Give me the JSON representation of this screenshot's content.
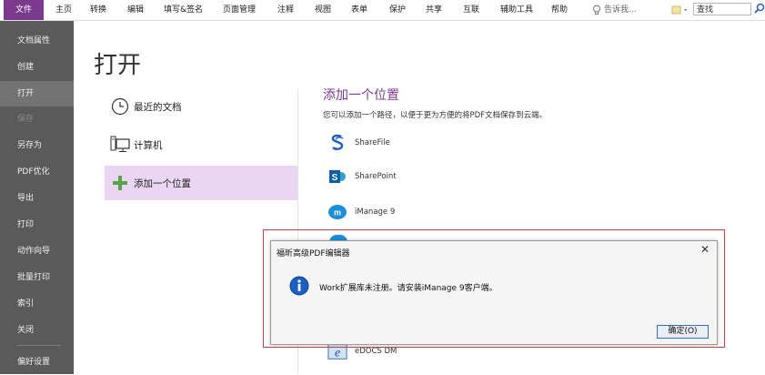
{
  "ribbon": {
    "tabs": [
      {
        "label": "文件",
        "active": true
      },
      {
        "label": "主页"
      },
      {
        "label": "转换"
      },
      {
        "label": "编辑"
      },
      {
        "label": "填写&签名"
      },
      {
        "label": "页面管理"
      },
      {
        "label": "注释"
      },
      {
        "label": "视图"
      },
      {
        "label": "表单"
      },
      {
        "label": "保护"
      },
      {
        "label": "共享"
      },
      {
        "label": "互联"
      },
      {
        "label": "辅助工具"
      },
      {
        "label": "帮助"
      }
    ],
    "tell_me": "告诉我...",
    "search_value": "查找",
    "accent_color": "#7c3a8f"
  },
  "sidebar": {
    "items": [
      {
        "label": "文档属性"
      },
      {
        "label": "创建"
      },
      {
        "label": "打开",
        "active": true
      },
      {
        "label": "保存",
        "disabled": true
      },
      {
        "label": "另存为"
      },
      {
        "label": "PDF优化"
      },
      {
        "label": "导出"
      },
      {
        "label": "打印"
      },
      {
        "label": "动作向导"
      },
      {
        "label": "批量打印"
      },
      {
        "label": "索引"
      },
      {
        "label": "关闭"
      },
      {
        "label": "偏好设置"
      }
    ]
  },
  "main": {
    "title": "打开",
    "locations": [
      {
        "label": "最近的文档",
        "icon": "clock-icon"
      },
      {
        "label": "计算机",
        "icon": "computer-icon"
      },
      {
        "label": "添加一个位置",
        "icon": "plus-icon",
        "active": true
      }
    ],
    "add_section": {
      "title": "添加一个位置",
      "description": "您可以添加一个路径，以便于更为方便的将PDF文档保存到云端。",
      "services": [
        {
          "label": "ShareFile",
          "icon": "sharefile-icon"
        },
        {
          "label": "SharePoint",
          "icon": "sharepoint-icon"
        },
        {
          "label": "iManage 9",
          "icon": "imanage-icon"
        },
        {
          "label": "eDOCS DM",
          "icon": "edocs-icon"
        }
      ]
    }
  },
  "dialog": {
    "title": "福昕高级PDF编辑器",
    "message": "Work扩展库未注册。请安装iManage 9客户端。",
    "ok_label": "确定(O)",
    "close_glyph": "✕"
  }
}
